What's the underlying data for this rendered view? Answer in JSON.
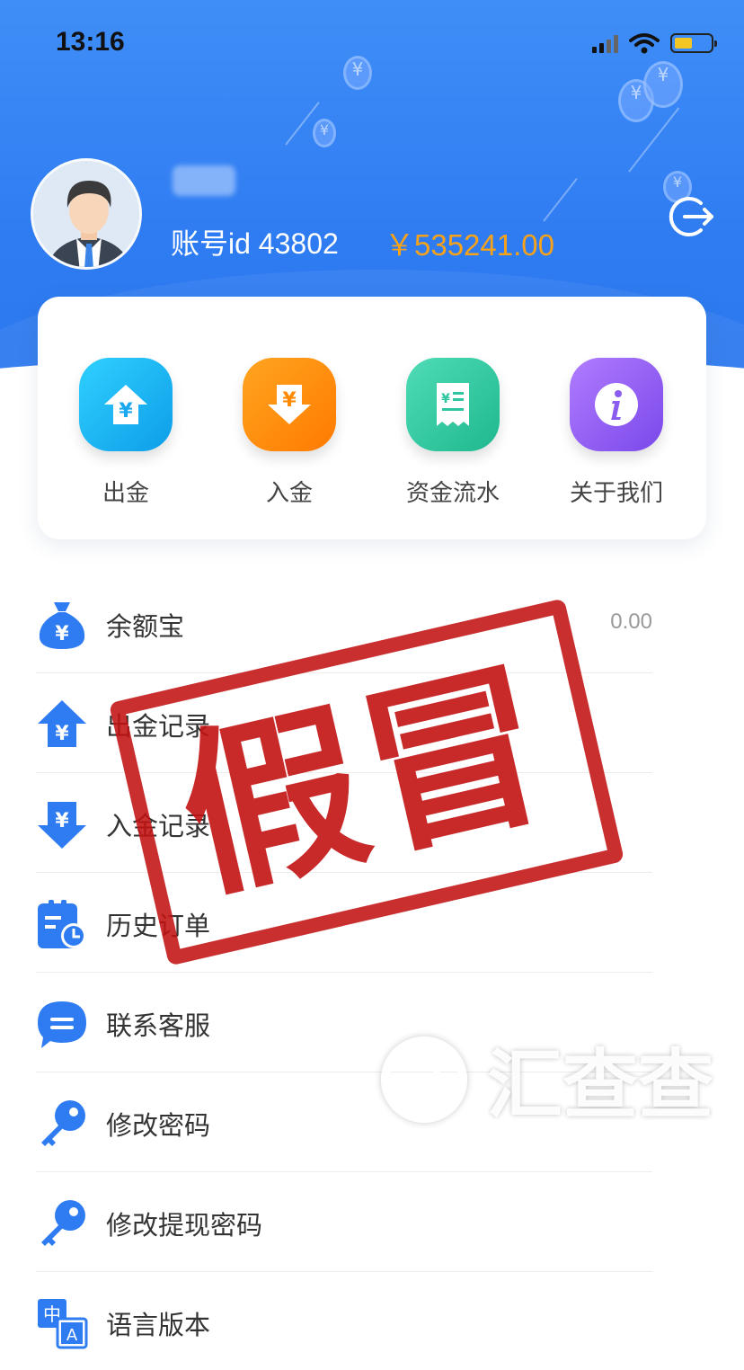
{
  "status_bar": {
    "time": "13:16"
  },
  "profile": {
    "account_id": "账号id 43802",
    "balance": "￥535241.00"
  },
  "quick_actions": [
    {
      "label": "出金",
      "icon": "withdraw-icon",
      "color": "#19b8f0"
    },
    {
      "label": "入金",
      "icon": "deposit-icon",
      "color": "#ff8a00"
    },
    {
      "label": "资金流水",
      "icon": "receipt-icon",
      "color": "#2ec6a0"
    },
    {
      "label": "关于我们",
      "icon": "info-icon",
      "color": "#8b5cf0"
    }
  ],
  "menu": [
    {
      "label": "余额宝",
      "value": "0.00",
      "icon": "money-bag-icon"
    },
    {
      "label": "出金记录",
      "icon": "withdraw-record-icon"
    },
    {
      "label": "入金记录",
      "icon": "deposit-record-icon"
    },
    {
      "label": "历史订单",
      "icon": "history-order-icon"
    },
    {
      "label": "联系客服",
      "icon": "chat-icon"
    },
    {
      "label": "修改密码",
      "icon": "key-icon"
    },
    {
      "label": "修改提现密码",
      "icon": "key-icon"
    },
    {
      "label": "语言版本",
      "icon": "language-icon"
    }
  ],
  "overlays": {
    "stamp_text": "假冒",
    "watermark_text": "汇查查"
  },
  "colors": {
    "header_blue": "#2f7cf2",
    "balance_orange": "#f7a21b",
    "icon_blue": "#2f7cf2",
    "stamp_red": "#c21212"
  }
}
